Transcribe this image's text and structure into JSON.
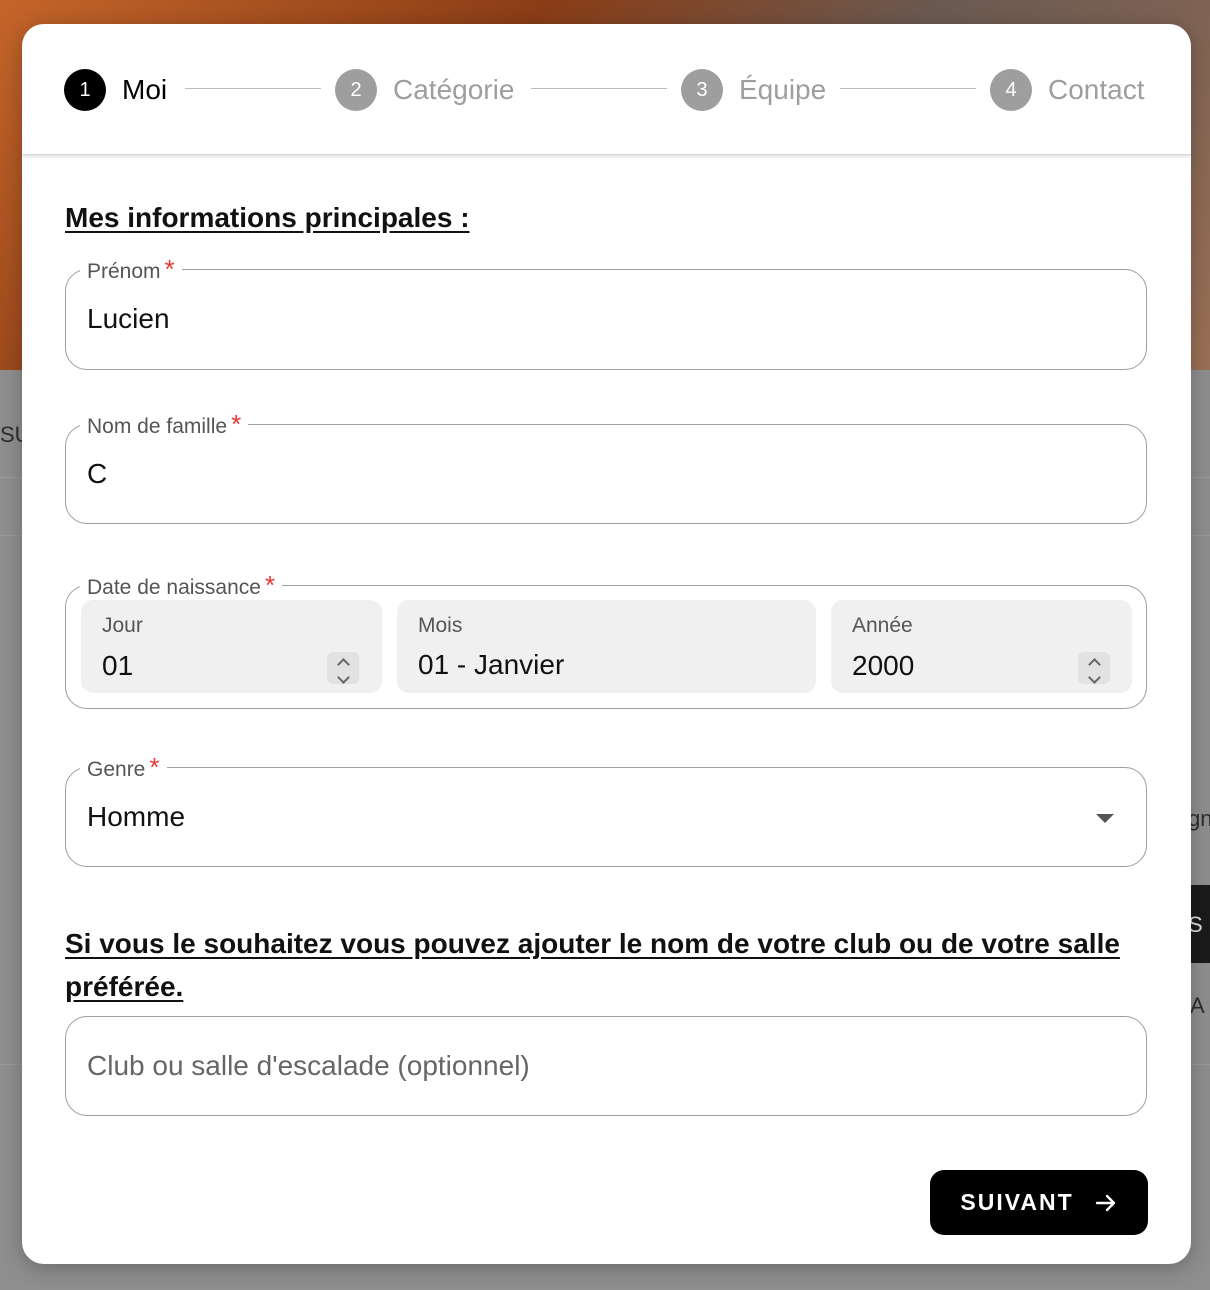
{
  "stepper": {
    "steps": [
      {
        "number": "1",
        "label": "Moi",
        "active": true
      },
      {
        "number": "2",
        "label": "Catégorie",
        "active": false
      },
      {
        "number": "3",
        "label": "Équipe",
        "active": false
      },
      {
        "number": "4",
        "label": "Contact",
        "active": false
      }
    ]
  },
  "form": {
    "section_title": "Mes informations principales :",
    "first_name": {
      "label": "Prénom",
      "required_mark": "*",
      "value": "Lucien"
    },
    "last_name": {
      "label": "Nom de famille",
      "required_mark": "*",
      "value": "C"
    },
    "birth_date": {
      "label": "Date de naissance",
      "required_mark": "*",
      "day": {
        "label": "Jour",
        "value": "01"
      },
      "month": {
        "label": "Mois",
        "value": "01 - Janvier"
      },
      "year": {
        "label": "Année",
        "value": "2000"
      }
    },
    "gender": {
      "label": "Genre",
      "required_mark": "*",
      "value": "Homme"
    },
    "club_section_title": "Si vous le souhaitez vous pouvez ajouter le nom de votre club ou de votre salle préférée.",
    "club": {
      "placeholder": "Club ou salle d'escalade (optionnel)",
      "value": ""
    },
    "submit_label": "SUIVANT"
  },
  "background": {
    "left_fragment": "SU",
    "right_fragment_1": "gn",
    "right_fragment_2": "S",
    "right_fragment_3": "A"
  },
  "colors": {
    "primary": "#000000",
    "required": "#e53935",
    "inactive_step": "#9e9e9e"
  },
  "icons": {
    "submit": "arrow-right-icon",
    "gender_select": "caret-down-icon",
    "spinners": "up-down-chevron-icon"
  }
}
